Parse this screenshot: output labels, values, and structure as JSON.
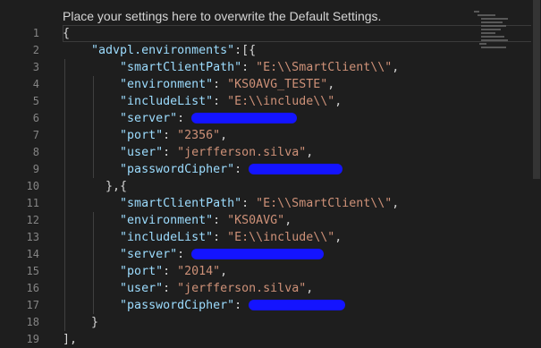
{
  "header": {
    "text": "Place your settings here to overwrite the Default Settings."
  },
  "line_numbers": [
    "1",
    "2",
    "3",
    "4",
    "5",
    "6",
    "7",
    "8",
    "9",
    "10",
    "11",
    "12",
    "13",
    "14",
    "15",
    "16",
    "17",
    "18",
    "19"
  ],
  "code": {
    "open_brace": "{",
    "env_key": "\"advpl.environments\"",
    "env_open": ":[{",
    "keys": {
      "smartClientPath": "\"smartClientPath\"",
      "environment": "\"environment\"",
      "includeList": "\"includeList\"",
      "server": "\"server\"",
      "port": "\"port\"",
      "user": "\"user\"",
      "passwordCipher": "\"passwordCipher\""
    },
    "colon": ": ",
    "comma": ",",
    "env1": {
      "smartClientPath": "\"E:\\\\SmartClient\\\\\"",
      "environment": "\"KS0AVG_TESTE\"",
      "includeList": "\"E:\\\\include\\\\\"",
      "port": "\"2356\"",
      "user": "\"jerfferson.silva\""
    },
    "env_separator": "},{",
    "env2": {
      "smartClientPath": "\"E:\\\\SmartClient\\\\\"",
      "environment": "\"KS0AVG\"",
      "includeList": "\"E:\\\\include\\\\\"",
      "port": "\"2014\"",
      "user": "\"jerfferson.silva\""
    },
    "close_object": "}",
    "close_array": "],"
  }
}
